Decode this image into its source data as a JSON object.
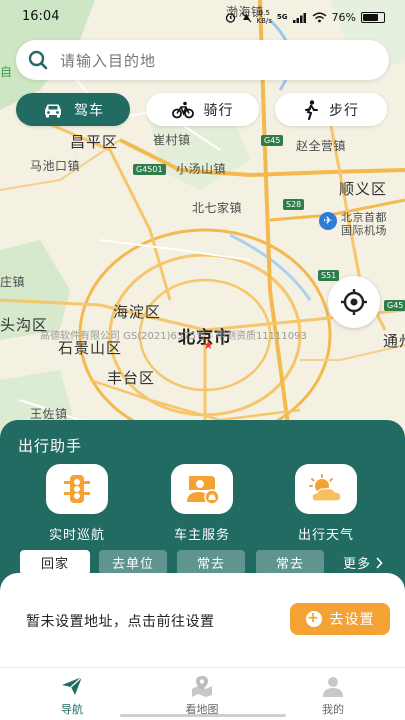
{
  "status_bar": {
    "time": "16:04",
    "network_speed_value": "0.5",
    "network_speed_unit": "KB/s",
    "network_type": "5G",
    "battery_percent": "76%",
    "battery_level": 0.76
  },
  "map": {
    "labels": {
      "bohai": "渤海镇",
      "changping": "昌平区",
      "cuicun": "崔村镇",
      "zhaoquanying": "赵全营镇",
      "machikou": "马池口镇",
      "xiaotangshan": "小汤山镇",
      "shunyi": "顺义区",
      "beiqijia": "北七家镇",
      "airport_line1": "北京首都",
      "airport_line2": "国际机场",
      "zhaizhen": "庄镇",
      "haidian": "海淀区",
      "toutougou": "头沟区",
      "shijingshan": "石景山区",
      "beijing": "北京市",
      "tongzhou": "通州",
      "fengtai": "丰台区",
      "wangzuo": "王佐镇",
      "zi": "自"
    },
    "road_badges": [
      "G45",
      "G4501",
      "S28",
      "S51",
      "G45"
    ],
    "copyright": "高德软件有限公司 GS(2021)6375号 - 甲测资质11111093"
  },
  "search": {
    "placeholder": "请输入目的地"
  },
  "modes": [
    {
      "label": "驾车",
      "icon": "car-icon"
    },
    {
      "label": "骑行",
      "icon": "bicycle-icon"
    },
    {
      "label": "步行",
      "icon": "walking-icon"
    }
  ],
  "assistant": {
    "title": "出行助手",
    "features": [
      {
        "label": "实时巡航",
        "icon": "traffic-light-icon"
      },
      {
        "label": "车主服务",
        "icon": "car-owner-icon"
      },
      {
        "label": "出行天气",
        "icon": "weather-icon"
      }
    ],
    "address_tabs": [
      "回家",
      "去单位",
      "常去",
      "常去"
    ],
    "more_label": "更多",
    "empty_message": "暂未设置地址，点击前往设置",
    "setup_label": "去设置"
  },
  "bottom_nav": [
    {
      "label": "导航",
      "icon": "navigation-arrow-icon"
    },
    {
      "label": "看地图",
      "icon": "map-icon"
    },
    {
      "label": "我的",
      "icon": "user-icon"
    }
  ],
  "colors": {
    "primary": "#226b62",
    "accent": "#f3a233",
    "tab_inactive": "#5f958e"
  }
}
